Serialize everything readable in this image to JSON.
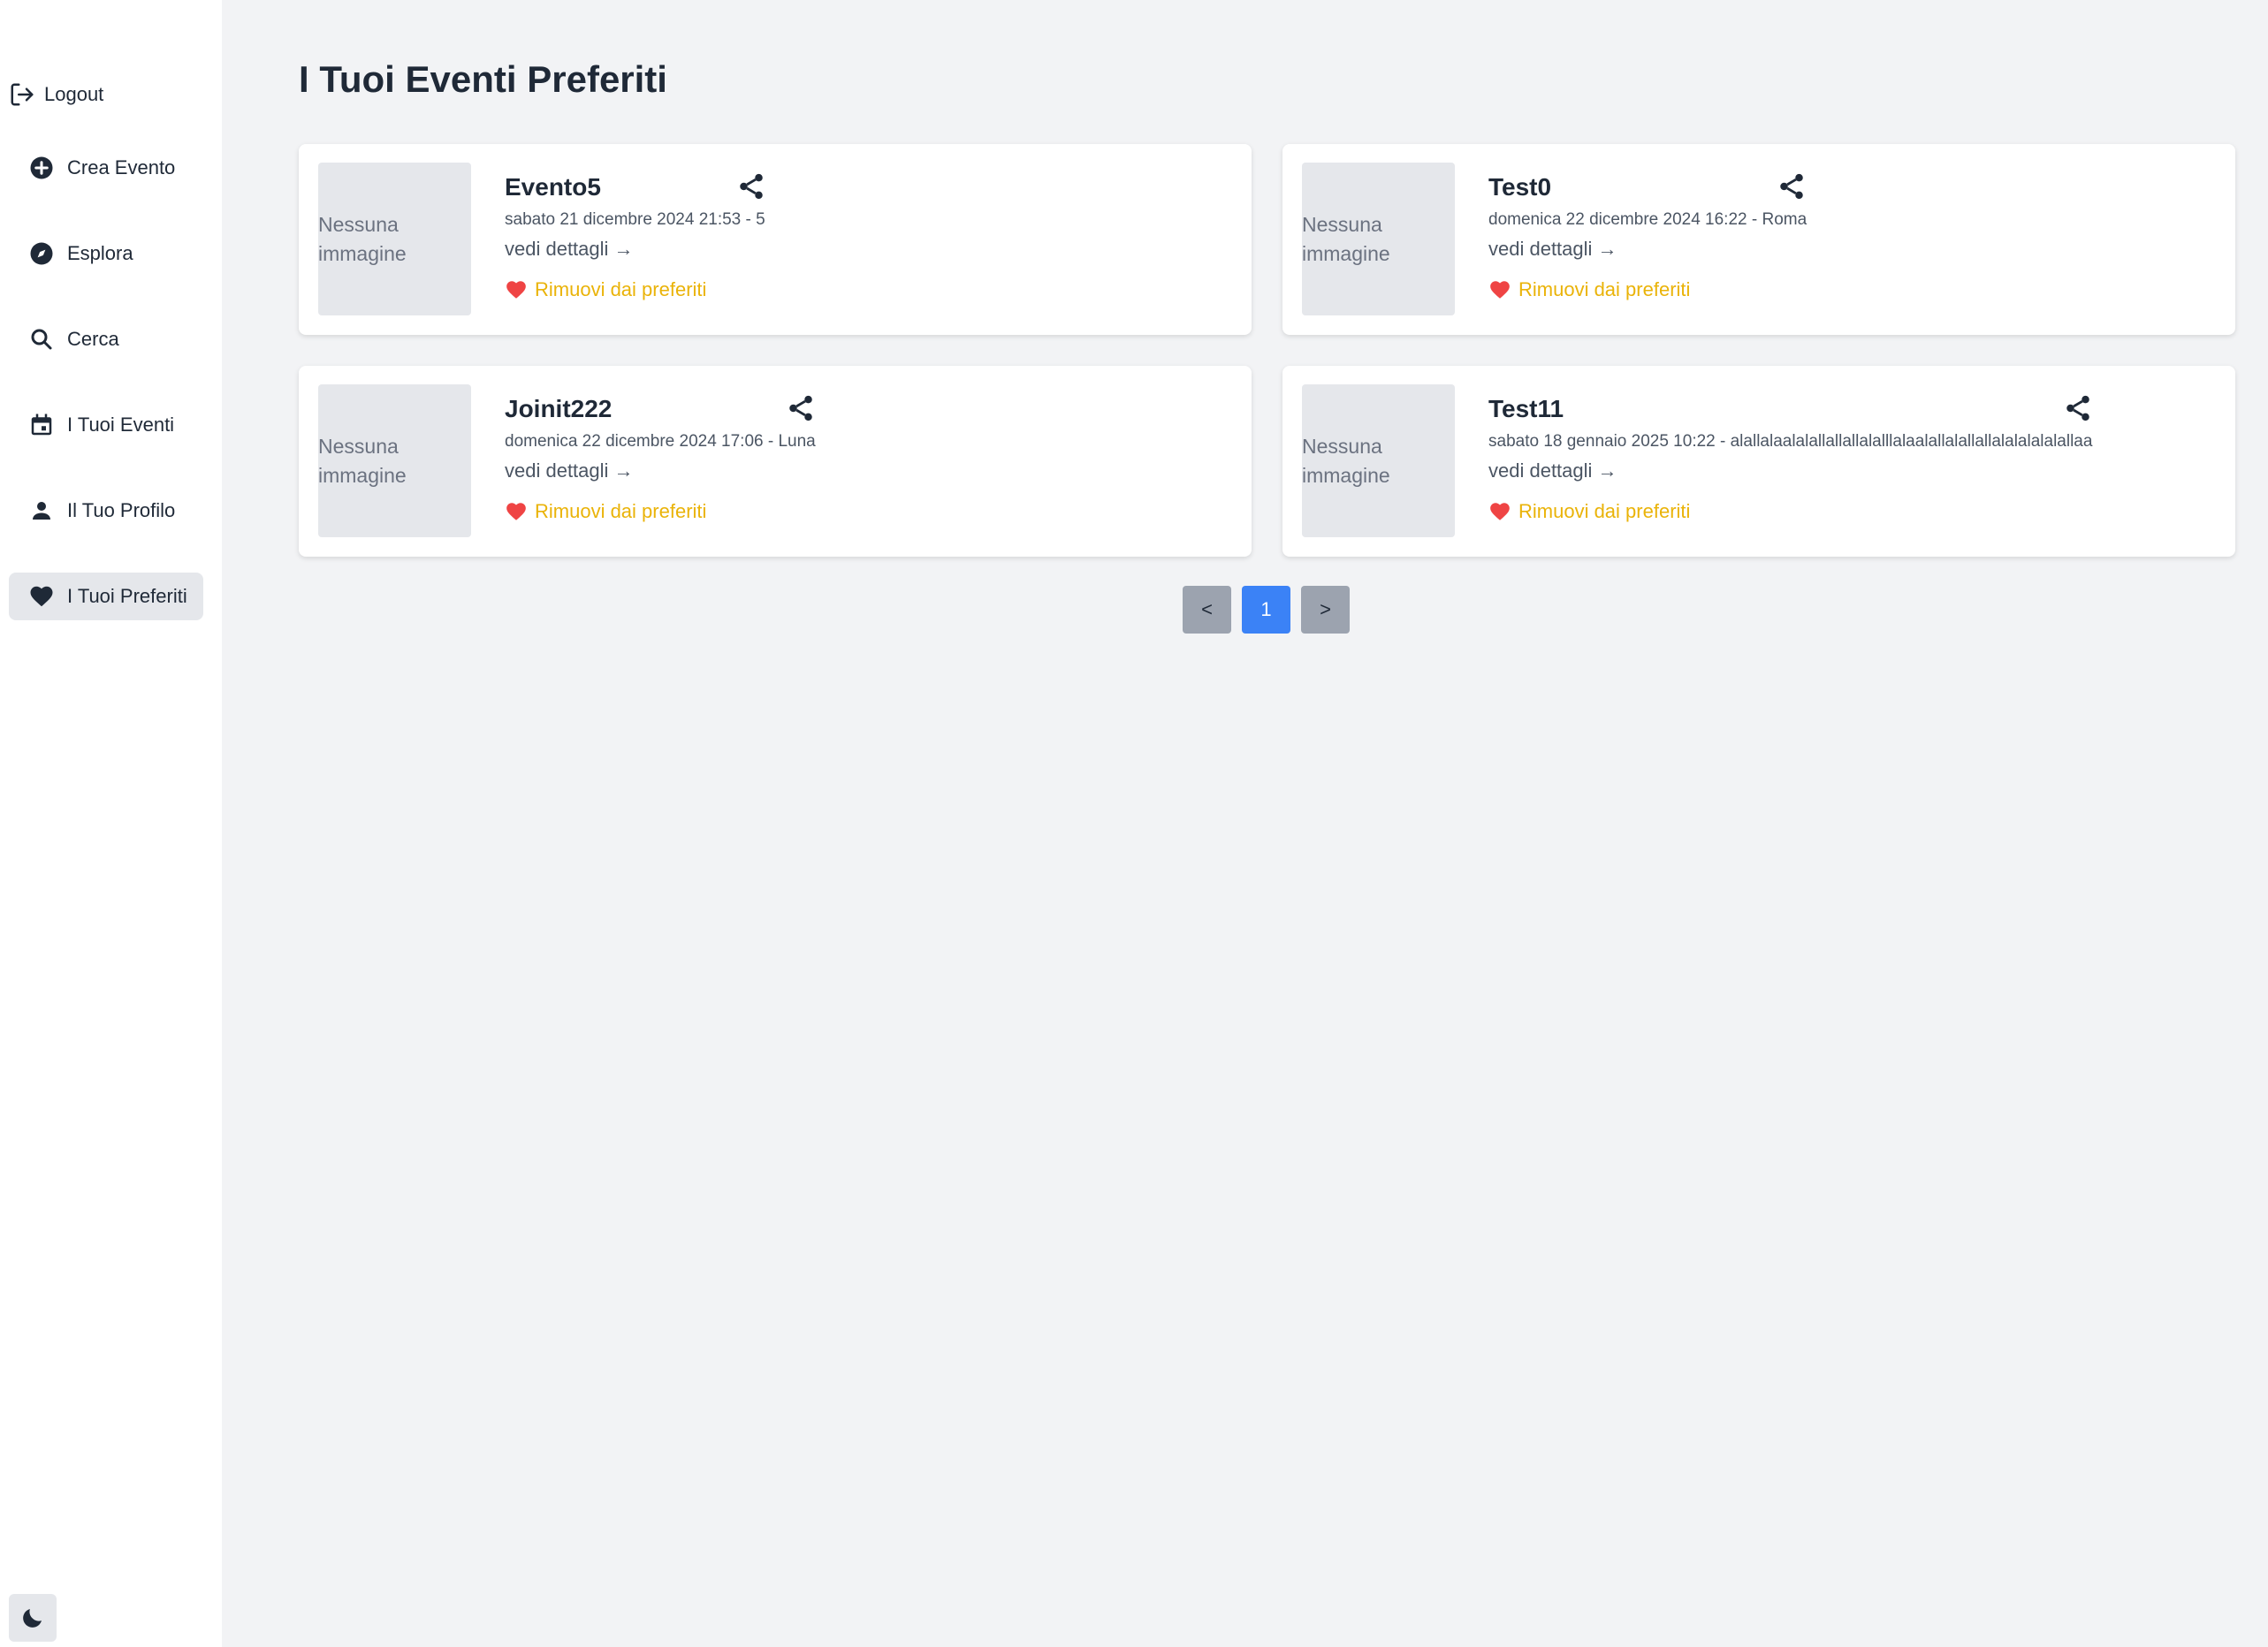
{
  "sidebar": {
    "logout_label": "Logout",
    "items": [
      {
        "label": "Crea Evento",
        "icon": "plus-circle-icon"
      },
      {
        "label": "Esplora",
        "icon": "compass-icon"
      },
      {
        "label": "Cerca",
        "icon": "search-icon"
      },
      {
        "label": "I Tuoi Eventi",
        "icon": "calendar-icon"
      },
      {
        "label": "Il Tuo Profilo",
        "icon": "person-icon"
      },
      {
        "label": "I Tuoi Preferiti",
        "icon": "heart-icon",
        "active": true
      }
    ],
    "theme_toggle_icon": "moon-icon"
  },
  "page": {
    "title": "I Tuoi Eventi Preferiti"
  },
  "events": [
    {
      "image_placeholder": "Nessuna immagine",
      "title": "Evento5",
      "meta": "sabato 21 dicembre 2024 21:53 - 5",
      "details_label": "vedi dettagli →",
      "remove_label": "Rimuovi dai preferiti"
    },
    {
      "image_placeholder": "Nessuna immagine",
      "title": "Test0",
      "meta": "domenica 22 dicembre 2024 16:22 - Roma",
      "details_label": "vedi dettagli →",
      "remove_label": "Rimuovi dai preferiti"
    },
    {
      "image_placeholder": "Nessuna immagine",
      "title": "Joinit222",
      "meta": "domenica 22 dicembre 2024 17:06 - Luna",
      "details_label": "vedi dettagli →",
      "remove_label": "Rimuovi dai preferiti"
    },
    {
      "image_placeholder": "Nessuna immagine",
      "title": "Test11",
      "meta": "sabato 18 gennaio 2025 10:22 - alallalaalalallallallalalllalaalallalallallalalalalalallaa",
      "details_label": "vedi dettagli →",
      "remove_label": "Rimuovi dai preferiti"
    }
  ],
  "pagination": {
    "prev_label": "<",
    "current_page": "1",
    "next_label": ">"
  },
  "colors": {
    "accent_blue": "#3b82f6",
    "remove_yellow": "#eab308",
    "heart_red": "#ef4444"
  }
}
